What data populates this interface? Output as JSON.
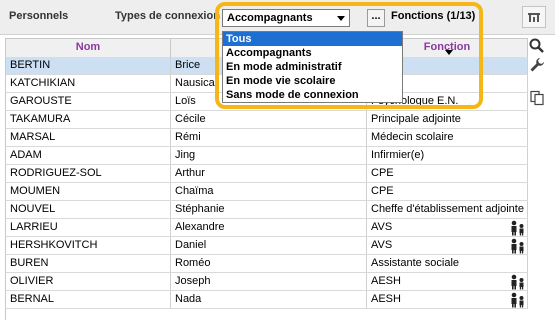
{
  "toolbar": {
    "title": "Personnels",
    "types_label": "Types de connexion",
    "types_value": "Accompagnants",
    "more_label": "...",
    "fonctions_label": "Fonctions (1/13)"
  },
  "dropdown": {
    "options": [
      "Tous",
      "Accompagnants",
      "En mode administratif",
      "En mode vie scolaire",
      "Sans mode de connexion"
    ],
    "highlighted": "Tous"
  },
  "table": {
    "columns": [
      "Nom",
      "",
      "Fonction"
    ],
    "rows": [
      {
        "nom": "BERTIN",
        "prenom": "Brice",
        "fonction": "...taire",
        "selected": true,
        "icon": false
      },
      {
        "nom": "KATCHIKIAN",
        "prenom": "Nausica",
        "fonction": "...taire",
        "selected": false,
        "icon": false
      },
      {
        "nom": "GAROUSTE",
        "prenom": "Loïs",
        "fonction": "Psychologue E.N.",
        "selected": false,
        "icon": false
      },
      {
        "nom": "TAKAMURA",
        "prenom": "Cécile",
        "fonction": "Principale adjointe",
        "selected": false,
        "icon": false
      },
      {
        "nom": "MARSAL",
        "prenom": "Rémi",
        "fonction": "Médecin scolaire",
        "selected": false,
        "icon": false
      },
      {
        "nom": "ADAM",
        "prenom": "Jing",
        "fonction": "Infirmier(e)",
        "selected": false,
        "icon": false
      },
      {
        "nom": "RODRIGUEZ-SOL",
        "prenom": "Arthur",
        "fonction": "CPE",
        "selected": false,
        "icon": false
      },
      {
        "nom": "MOUMEN",
        "prenom": "Chaïma",
        "fonction": "CPE",
        "selected": false,
        "icon": false
      },
      {
        "nom": "NOUVEL",
        "prenom": "Stéphanie",
        "fonction": "Cheffe d'établissement adjointe",
        "selected": false,
        "icon": false
      },
      {
        "nom": "LARRIEU",
        "prenom": "Alexandre",
        "fonction": "AVS",
        "selected": false,
        "icon": true
      },
      {
        "nom": "HERSHKOVITCH",
        "prenom": "Daniel",
        "fonction": "AVS",
        "selected": false,
        "icon": true
      },
      {
        "nom": "BUREN",
        "prenom": "Roméo",
        "fonction": "Assistante sociale",
        "selected": false,
        "icon": false
      },
      {
        "nom": "OLIVIER",
        "prenom": "Joseph",
        "fonction": "AESH",
        "selected": false,
        "icon": true
      },
      {
        "nom": "BERNAL",
        "prenom": "Nada",
        "fonction": "AESH",
        "selected": false,
        "icon": true
      }
    ]
  },
  "icons": {
    "side_tools": [
      "search-icon",
      "wrench-icon",
      "copy-icon"
    ],
    "row_icon": "accompanied-people-icon",
    "toolbar_right": "chart-icon"
  },
  "colors": {
    "header_text": "#8a3a9f",
    "selection": "#cde0f3",
    "highlight": "#1d6fd1",
    "popup_border": "#f5b718"
  }
}
